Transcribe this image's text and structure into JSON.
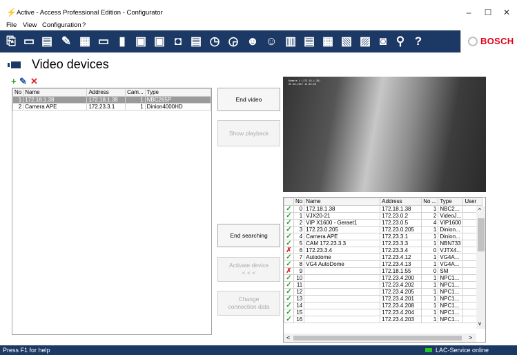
{
  "window": {
    "title": "Active - Access Professional Edition - Configurator",
    "minimize": "–",
    "maximize": "☐",
    "close": "✕"
  },
  "menu": [
    "File",
    "View",
    "Configuration",
    "?"
  ],
  "toolbar": {
    "icons": [
      "new-icon",
      "open-folder-icon",
      "save-icon",
      "tools-icon",
      "device-config-icon",
      "card-reader-icon",
      "door-icon",
      "output-panel-icon",
      "input-panel-icon",
      "video-device-icon",
      "schedule-icon",
      "time-model-icon",
      "day-model-icon",
      "persons-group-icon",
      "personnel-data-icon",
      "card-data-icon",
      "text-data-icon",
      "text-extra-icon",
      "date-data-icon",
      "card-print-icon",
      "video-icon",
      "location-icon",
      "help-icon"
    ],
    "brand": "BOSCH"
  },
  "page": {
    "title": "Video devices"
  },
  "devices": {
    "columns": [
      "No",
      "Name",
      "Address",
      "Cam...",
      "Type"
    ],
    "rows": [
      [
        "1",
        "172.18.1.38",
        "172.18.1.38",
        "1",
        "NBC265P"
      ],
      [
        "2",
        "Camera APE",
        "172.23.3.1",
        "1",
        "Dinion4000HD"
      ]
    ]
  },
  "buttons": {
    "end_video": "End video",
    "show_playback": "Show playback",
    "end_searching": "End searching",
    "activate_device": "Activate device\n< < <",
    "change_connection": "Change\nconnection data"
  },
  "video": {
    "osd_line1": "Kamera 1 (172.18.1.38)",
    "osd_line2": "02.06.2017 13:45:29"
  },
  "search": {
    "columns": [
      "",
      "No",
      "Name",
      "Address",
      "No ...",
      "Type",
      "User"
    ],
    "rows": [
      [
        "ok",
        "0",
        "172.18.1.38",
        "172.18.1.38",
        "1",
        "NBC2..."
      ],
      [
        "ok",
        "1",
        "VJX20-21",
        "172.23.0.2",
        "2",
        "VideoJ..."
      ],
      [
        "ok",
        "2",
        "VIP X1600 - Geraet1",
        "172.23.0.5",
        "4",
        "VIP1600"
      ],
      [
        "ok",
        "3",
        "172.23.0.205",
        "172.23.0.205",
        "1",
        "Dinion..."
      ],
      [
        "ok",
        "4",
        "Camera APE",
        "172.23.3.1",
        "1",
        "Dinion..."
      ],
      [
        "ok",
        "5",
        "CAM 172.23.3.3",
        "172.23.3.3",
        "1",
        "NBN733"
      ],
      [
        "bad",
        "6",
        "172.23.3.4",
        "172.23.3.4",
        "0",
        "VJTX4..."
      ],
      [
        "ok",
        "7",
        "Autodome",
        "172.23.4.12",
        "1",
        "VG4A..."
      ],
      [
        "ok",
        "8",
        "VG4 AutoDome",
        "172.23.4.13",
        "1",
        "VG4A..."
      ],
      [
        "bad",
        "9",
        "",
        "172.18.1.55",
        "0",
        "SM"
      ],
      [
        "ok",
        "10",
        "",
        "172.23.4.200",
        "1",
        "NPC1..."
      ],
      [
        "ok",
        "11",
        "",
        "172.23.4.202",
        "1",
        "NPC1..."
      ],
      [
        "ok",
        "12",
        "",
        "172.23.4.205",
        "1",
        "NPC1..."
      ],
      [
        "ok",
        "13",
        "",
        "172.23.4.201",
        "1",
        "NPC1..."
      ],
      [
        "ok",
        "14",
        "",
        "172.23.4.208",
        "1",
        "NPC1..."
      ],
      [
        "ok",
        "15",
        "",
        "172.23.4.204",
        "1",
        "NPC1..."
      ],
      [
        "ok",
        "16",
        "",
        "172.23.4.203",
        "1",
        "NPC1..."
      ]
    ]
  },
  "status": {
    "left": "Press F1 for help",
    "right": "LAC-Service online"
  },
  "colors": {
    "toolbar": "#1c3966",
    "brand": "#e2001a",
    "ok": "#2a9d2a",
    "bad": "#d9232d",
    "online": "#22c722"
  }
}
